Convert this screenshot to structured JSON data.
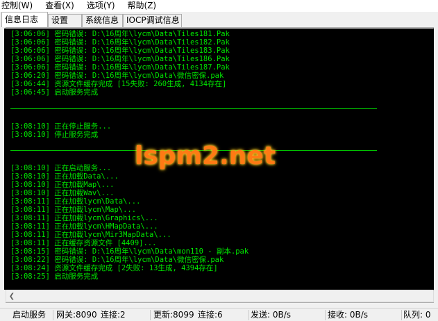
{
  "menu": [
    {
      "label": "控制(W)"
    },
    {
      "label": "查看(X)"
    },
    {
      "label": "选项(Y)"
    },
    {
      "label": "帮助(Z)"
    }
  ],
  "tabs": [
    {
      "label": "信息日志",
      "active": true
    },
    {
      "label": "设置",
      "active": false
    },
    {
      "label": "系统信息",
      "active": false
    },
    {
      "label": "IOCP调试信息",
      "active": false
    }
  ],
  "log": {
    "block1": [
      "[3:06:06] 密码错误: D:\\16周年\\lycm\\Data\\Tiles181.Pak",
      "[3:06:06] 密码错误: D:\\16周年\\lycm\\Data\\Tiles182.Pak",
      "[3:06:06] 密码错误: D:\\16周年\\lycm\\Data\\Tiles183.Pak",
      "[3:06:06] 密码错误: D:\\16周年\\lycm\\Data\\Tiles186.Pak",
      "[3:06:06] 密码错误: D:\\16周年\\lycm\\Data\\Tiles187.Pak",
      "[3:06:20] 密码错误: D:\\16周年\\lycm\\Data\\微信密保.pak",
      "[3:06:44] 资源文件缓存完成 [15失败: 260生成, 4134存在]",
      "[3:06:45] 启动服务完成"
    ],
    "block2": [
      "[3:08:10] 正在停止服务...",
      "[3:08:10] 停止服务完成"
    ],
    "block3": [
      "[3:08:10] 正在启动服务...",
      "[3:08:10] 正在加载Data\\...",
      "[3:08:10] 正在加载Map\\...",
      "[3:08:10] 正在加载Wav\\...",
      "[3:08:11] 正在加载lycm\\Data\\...",
      "[3:08:11] 正在加载lycm\\Map\\...",
      "[3:08:11] 正在加载lycm\\Graphics\\...",
      "[3:08:11] 正在加载lycm\\HMapData\\...",
      "[3:08:11] 正在加载lycm\\Mir3MapData\\...",
      "[3:08:11] 正在缓存资源文件 [4409]...",
      "[3:08:15] 密码错误: D:\\16周年\\lycm\\Data\\mon110 - 副本.pak",
      "[3:08:22] 密码错误: D:\\16周年\\lycm\\Data\\微信密保.pak",
      "[3:08:24] 资源文件缓存完成 [2失败: 13生成, 4394存在]",
      "[3:08:25] 启动服务完成"
    ]
  },
  "watermark": "lspm2.net",
  "status": {
    "service": "启动服务",
    "gateway": "网关:8090",
    "conn1": "连接:2",
    "update": "更新:8099",
    "conn2": "连接:6",
    "send": "发送: 0B/s",
    "recv": "接收: 0B/s",
    "queue": "队列: 0"
  },
  "colors": {
    "console_bg": "#000000",
    "console_text": "#00e600",
    "watermark": "#ff7a14"
  }
}
